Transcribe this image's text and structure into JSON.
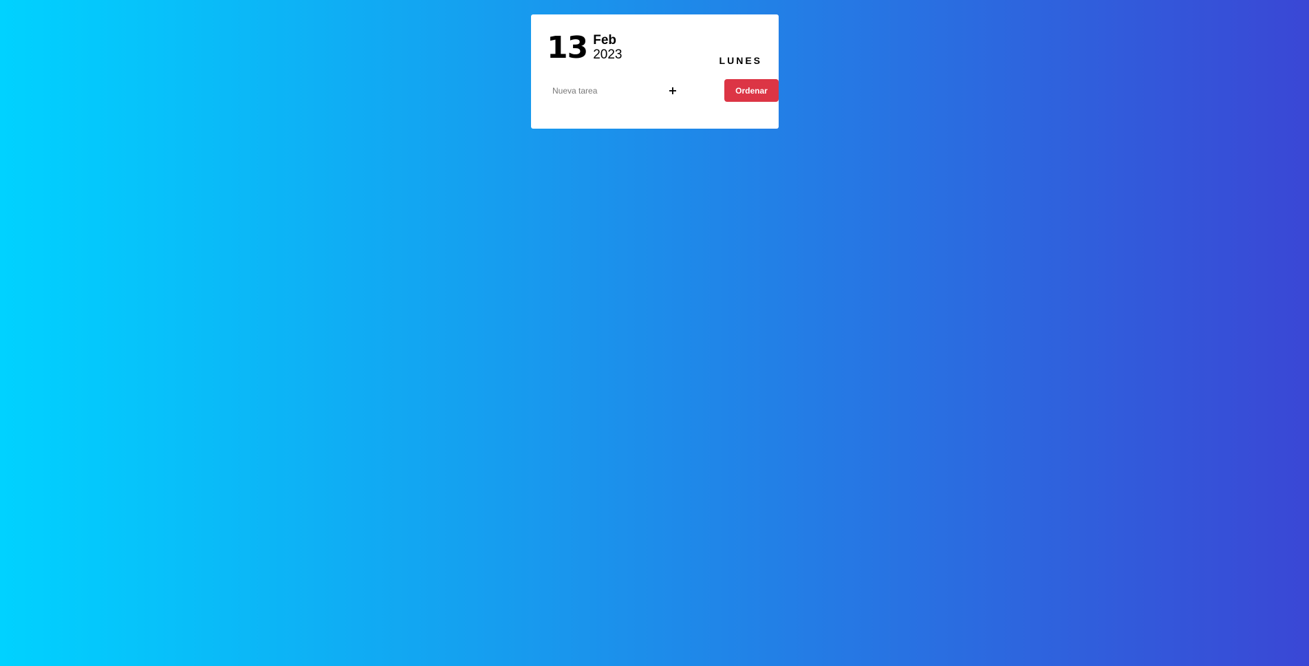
{
  "date": {
    "day": "13",
    "month": "Feb",
    "year": "2023",
    "weekday": "LUNES"
  },
  "task_form": {
    "input_placeholder": "Nueva tarea",
    "input_value": "",
    "add_label": "+",
    "order_label": "Ordenar"
  },
  "colors": {
    "background_start": "#00d2ff",
    "background_end": "#3a47d5",
    "order_button": "#dc3545"
  }
}
